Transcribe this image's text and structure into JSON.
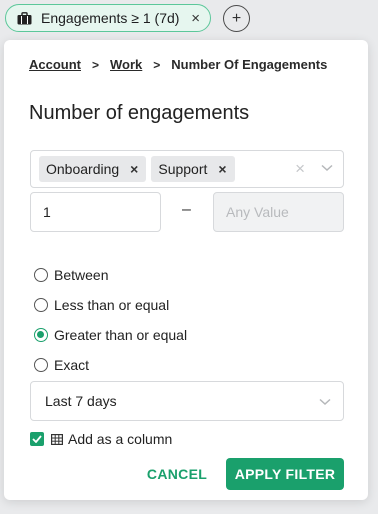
{
  "chip": {
    "label": "Engagements ≥ 1 (7d)",
    "icon": "briefcase-icon",
    "close": "×"
  },
  "add_button": {
    "label": "+"
  },
  "breadcrumb": {
    "items": [
      "Account",
      "Work",
      "Number Of Engagements"
    ],
    "separator": ">"
  },
  "panel_title": "Number of engagements",
  "multiselect": {
    "tags": [
      {
        "label": "Onboarding",
        "remove": "×"
      },
      {
        "label": "Support",
        "remove": "×"
      }
    ],
    "clear": "×"
  },
  "range": {
    "from_value": "1",
    "separator": "–",
    "to_placeholder": "Any Value"
  },
  "operators": {
    "options": [
      "Between",
      "Less than or equal",
      "Greater than or equal",
      "Exact"
    ],
    "selected": "Greater than or equal"
  },
  "period": {
    "value": "Last 7 days"
  },
  "add_column": {
    "label": "Add as a column",
    "checked": true
  },
  "actions": {
    "cancel": "CANCEL",
    "apply": "APPLY FILTER"
  },
  "colors": {
    "accent": "#1aa06c",
    "chip_bg": "#e6f6ef"
  }
}
